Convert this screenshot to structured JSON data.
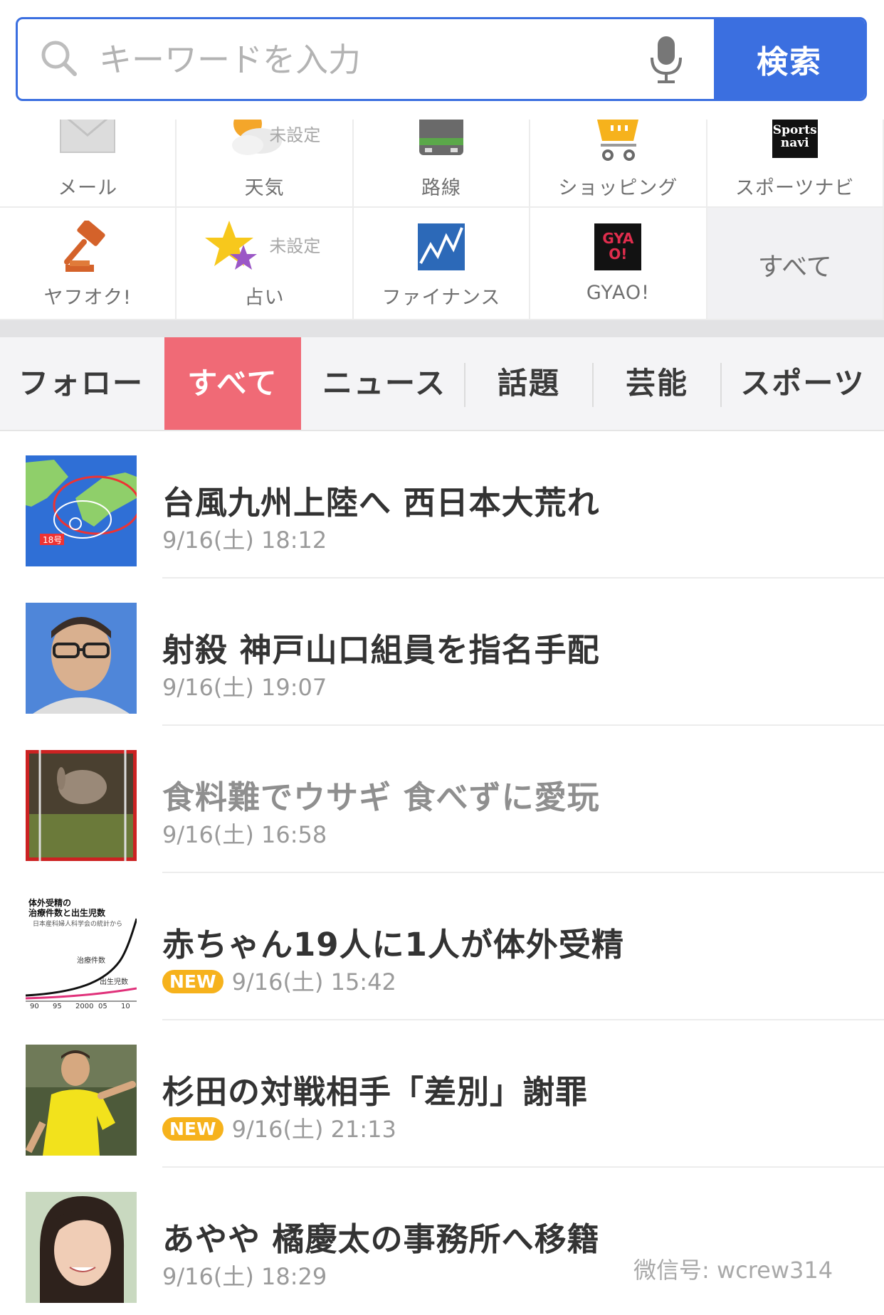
{
  "search": {
    "placeholder": "キーワードを入力",
    "button_label": "検索"
  },
  "services": [
    {
      "label": "メール",
      "icon": "mail-icon"
    },
    {
      "label": "天気",
      "icon": "weather-icon",
      "note": "未設定"
    },
    {
      "label": "路線",
      "icon": "train-icon"
    },
    {
      "label": "ショッピング",
      "icon": "cart-icon"
    },
    {
      "label": "スポーツナビ",
      "icon": "sportsnavi-icon"
    },
    {
      "label": "ヤフオク!",
      "icon": "auction-gavel-icon"
    },
    {
      "label": "占い",
      "icon": "fortune-star-icon",
      "note": "未設定"
    },
    {
      "label": "ファイナンス",
      "icon": "finance-chart-icon"
    },
    {
      "label": "GYAO!",
      "icon": "gyao-icon"
    },
    {
      "label": "すべて"
    }
  ],
  "tabs": [
    {
      "label": "フォロー",
      "active": false
    },
    {
      "label": "すべて",
      "active": true
    },
    {
      "label": "ニュース",
      "active": false
    },
    {
      "label": "話題",
      "active": false
    },
    {
      "label": "芸能",
      "active": false
    },
    {
      "label": "スポーツ",
      "active": false
    }
  ],
  "news": [
    {
      "title": "台風九州上陸へ 西日本大荒れ",
      "time": "9/16(土) 18:12",
      "new": false,
      "visited": false,
      "thumb": "typhoon-map"
    },
    {
      "title": "射殺 神戸山口組員を指名手配",
      "time": "9/16(土) 19:07",
      "new": false,
      "visited": false,
      "thumb": "suspect-photo"
    },
    {
      "title": "食料難でウサギ 食べずに愛玩",
      "time": "9/16(土) 16:58",
      "new": false,
      "visited": true,
      "thumb": "rabbit-photo"
    },
    {
      "title": "赤ちゃん19人に1人が体外受精",
      "time": "9/16(土) 15:42",
      "new": true,
      "visited": false,
      "thumb": "ivf-chart"
    },
    {
      "title": "杉田の対戦相手「差別」謝罪",
      "time": "9/16(土) 21:13",
      "new": true,
      "visited": false,
      "thumb": "tennis-player"
    },
    {
      "title": "あやや 橘慶太の事務所へ移籍",
      "time": "9/16(土) 18:29",
      "new": false,
      "visited": false,
      "thumb": "woman-portrait"
    }
  ],
  "badge_new": "NEW",
  "ivf_chart_text": {
    "title_line1": "体外受精の",
    "title_line2": "治療件数と出生児数",
    "source": "日本産科婦人科学会の統計から",
    "series_a": "治療件数",
    "series_b": "出生児数",
    "ticks": [
      "90",
      "95",
      "2000",
      "05",
      "10"
    ]
  },
  "typhoon_map_text": {
    "label": "18号"
  },
  "sportsnavi_text": "Sports navi",
  "gyao_text": "GYAO!",
  "watermark": "微信号: wcrew314",
  "colors": {
    "accent": "#3b6fe0",
    "active_tab": "#f06a76",
    "new_badge": "#f6b21c"
  }
}
